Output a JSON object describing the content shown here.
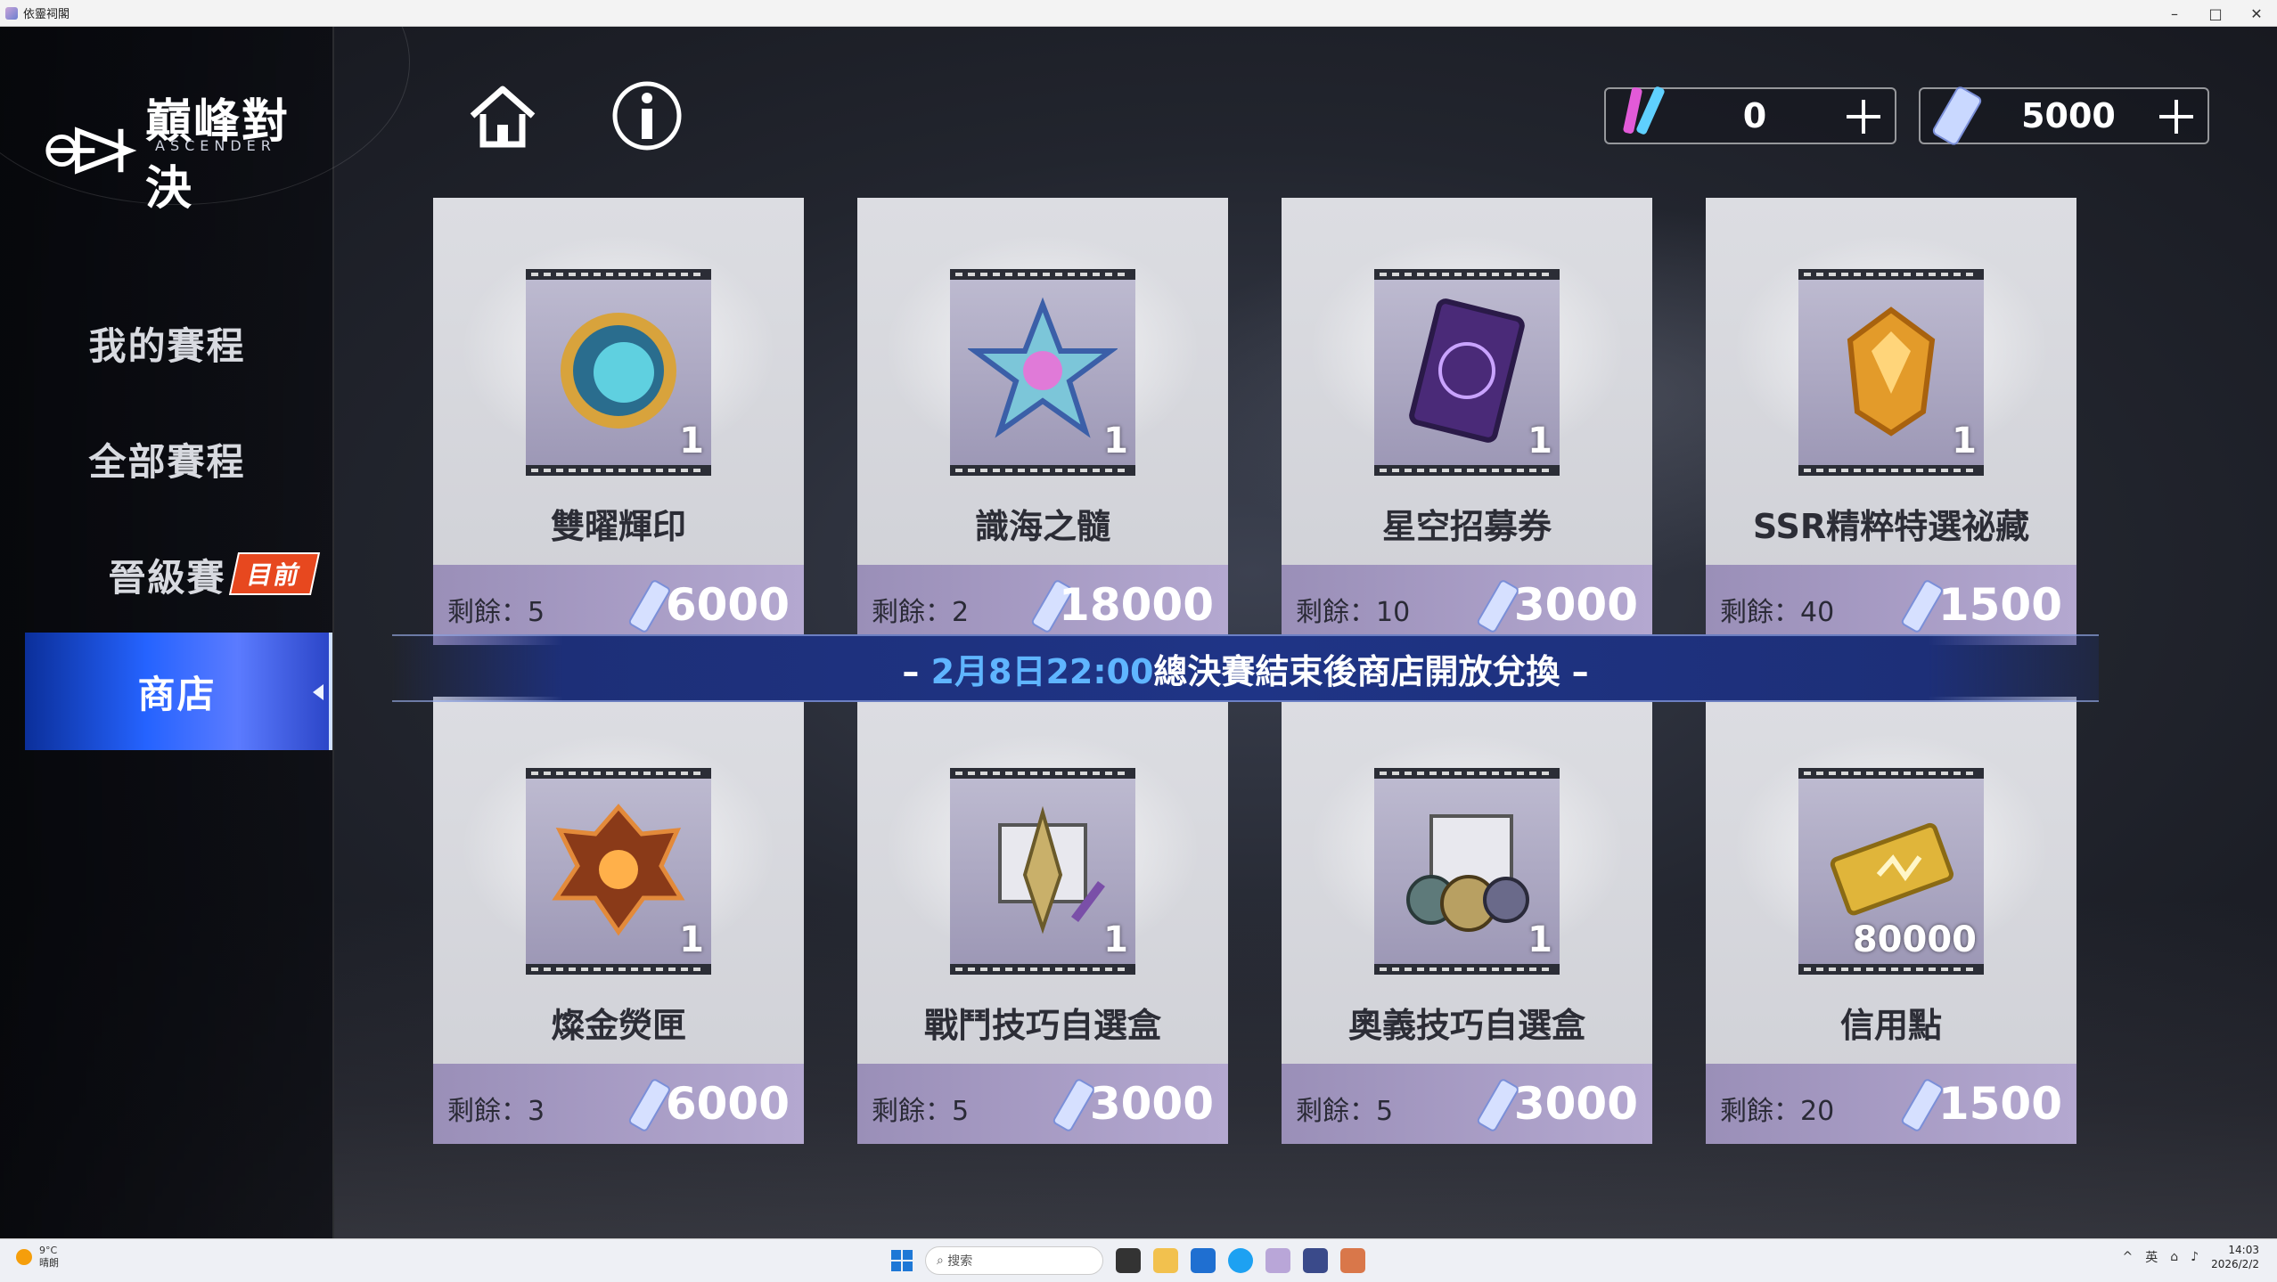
{
  "window": {
    "title": "依靈祠閣",
    "controls": [
      "–",
      "□",
      "✕"
    ]
  },
  "logo": {
    "title": "巔峰對決",
    "subtitle": "ASCENDER"
  },
  "nav": {
    "items": [
      {
        "label": "我的賽程",
        "active": false,
        "badge": ""
      },
      {
        "label": "全部賽程",
        "active": false,
        "badge": ""
      },
      {
        "label": "晉級賽",
        "active": false,
        "badge": "目前"
      },
      {
        "label": "商店",
        "active": true,
        "badge": ""
      }
    ]
  },
  "toolbar": {
    "home_icon": "home-icon",
    "info_icon": "info-icon"
  },
  "currencies": [
    {
      "icon": "glowstick-icon",
      "value": "0",
      "plus": "+"
    },
    {
      "icon": "ticket-icon",
      "value": "5000",
      "plus": "+"
    }
  ],
  "banner": {
    "prefix": "– ",
    "highlight": "2月8日22:00",
    "text": "總決賽結束後商店開放兌換",
    "suffix": " –"
  },
  "shop": {
    "remain_label": "剩餘：",
    "items": [
      {
        "name": "雙曜輝印",
        "qty": "1",
        "remain": "5",
        "price": "6000",
        "icon": "emblem-icon",
        "art": "#d8a33c"
      },
      {
        "name": "識海之髓",
        "qty": "1",
        "remain": "2",
        "price": "18000",
        "icon": "star-crystal-icon",
        "art": "#7cc6d9"
      },
      {
        "name": "星空招募券",
        "qty": "1",
        "remain": "10",
        "price": "3000",
        "icon": "card-icon",
        "art": "#6a3fa0"
      },
      {
        "name": "SSR精粹特選祕藏",
        "qty": "1",
        "remain": "40",
        "price": "1500",
        "icon": "gem-icon",
        "art": "#e39b2a"
      },
      {
        "name": "燦金熒匣",
        "qty": "1",
        "remain": "3",
        "price": "6000",
        "icon": "gold-box-icon",
        "art": "#c85a22"
      },
      {
        "name": "戰鬥技巧自選盒",
        "qty": "1",
        "remain": "5",
        "price": "3000",
        "icon": "battle-box-icon",
        "art": "#c9b06a"
      },
      {
        "name": "奧義技巧自選盒",
        "qty": "1",
        "remain": "5",
        "price": "3000",
        "icon": "skill-box-icon",
        "art": "#8a8f7a"
      },
      {
        "name": "信用點",
        "qty": "80000",
        "remain": "20",
        "price": "1500",
        "icon": "credit-ticket-icon",
        "art": "#e0b53a"
      }
    ]
  },
  "taskbar": {
    "weather": {
      "temp": "9°C",
      "desc": "晴朗"
    },
    "search_placeholder": "搜索",
    "tray": {
      "lang": "英",
      "time": "14:03",
      "date": "2026/2/2"
    }
  },
  "colors": {
    "accent_blue": "#2563ff",
    "banner_highlight": "#5fb5ff",
    "badge_red": "#e7481f",
    "card_footer": "#a79cc6"
  }
}
